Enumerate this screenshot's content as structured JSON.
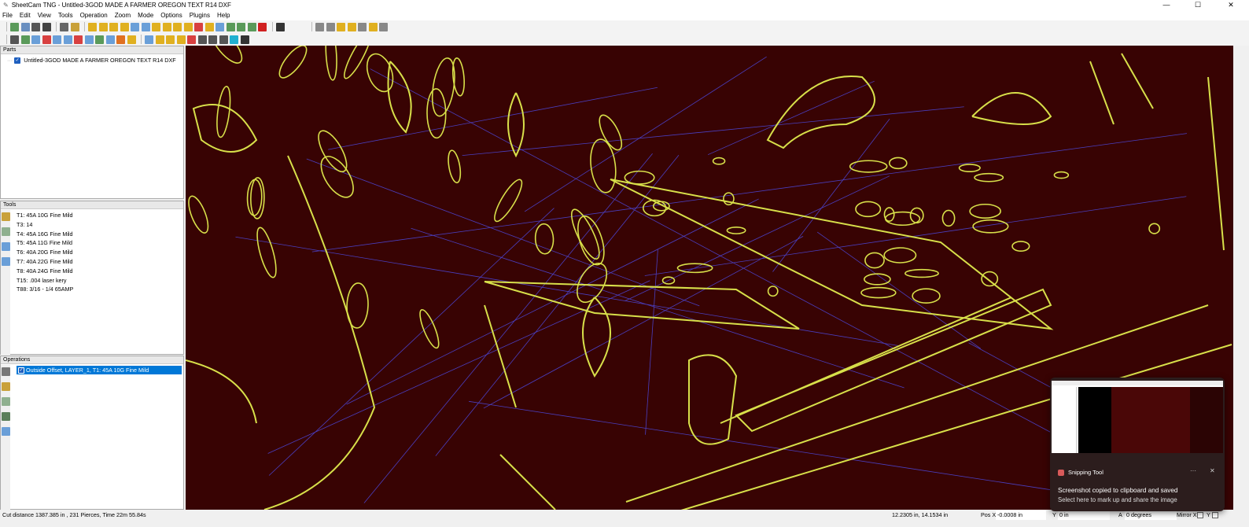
{
  "window": {
    "title": "SheetCam TNG - Untitled-3GOD MADE A FARMER OREGON TEXT R14 DXF",
    "minimize": "—",
    "maximize": "☐",
    "close": "✕"
  },
  "menu": [
    "File",
    "Edit",
    "View",
    "Tools",
    "Operation",
    "Zoom",
    "Mode",
    "Options",
    "Plugins",
    "Help"
  ],
  "parts": {
    "header": "Parts",
    "items": [
      {
        "label": "Untitled-3GOD MADE A FARMER OREGON TEXT R14 DXF",
        "checked": true
      }
    ]
  },
  "tools": {
    "header": "Tools",
    "items": [
      "T1: 45A 10G Fine Mild",
      "T3: 14",
      "T4: 45A 16G Fine Mild",
      "T5: 45A 11G Fine Mild",
      "T6: 40A 20G Fine Mild",
      "T7: 40A 22G Fine Mild",
      "T8: 40A 24G Fine Mild",
      "T15: .004 laser kery",
      "T88: 3/16 - 1/4 65AMP"
    ]
  },
  "operations": {
    "header": "Operations",
    "items": [
      {
        "label": "Outside Offset, LAYER_1, T1: 45A 10G Fine Mild",
        "checked": true,
        "selected": true
      }
    ]
  },
  "status": {
    "summary": "Cut distance 1387.385 in , 231 Pierces, Time 22m 55.84s",
    "cursor": "12.2305 in, 14.1534 in",
    "pos_x_label": "Pos X",
    "pos_x": "-0.0008 in",
    "y_label": "Y",
    "y": "0 in",
    "a_label": "A",
    "a": "0 degrees",
    "mirror_label": "Mirror X",
    "mirror_y_label": "Y"
  },
  "toast": {
    "app": "Snipping Tool",
    "title": "Screenshot copied to clipboard and saved",
    "body": "Select here to mark up and share the image",
    "more": "···",
    "close": "✕"
  },
  "colors": {
    "canvas": "#380303",
    "path": "#d8e04a",
    "rapid": "#4a3fc0",
    "selection": "#0078d7"
  }
}
